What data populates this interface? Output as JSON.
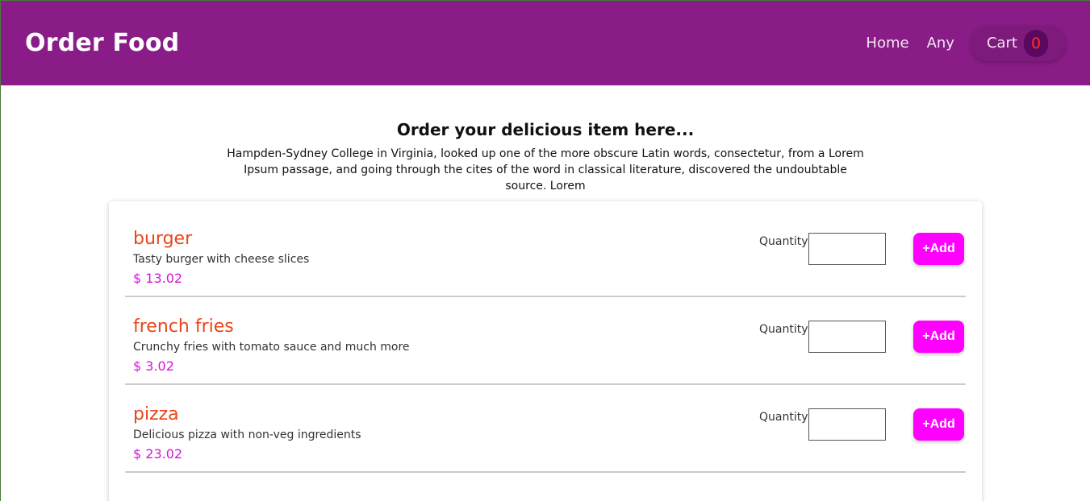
{
  "header": {
    "brand": "Order Food",
    "nav": [
      {
        "label": "Home"
      },
      {
        "label": "Any"
      }
    ],
    "cart": {
      "label": "Cart",
      "count": "0"
    }
  },
  "intro": {
    "title": "Order your delicious item here...",
    "text": "Hampden-Sydney College in Virginia, looked up one of the more obscure Latin words, consectetur, from a Lorem Ipsum passage, and going through the cites of the word in classical literature, discovered the undoubtable source. Lorem"
  },
  "meals": [
    {
      "name": "burger",
      "description": "Tasty burger with cheese slices",
      "price": "$ 13.02",
      "quantity_label": "Quantity:",
      "quantity_value": "",
      "add_label": "+Add"
    },
    {
      "name": "french fries",
      "description": "Crunchy fries with tomato sauce and much more",
      "price": "$ 3.02",
      "quantity_label": "Quantity:",
      "quantity_value": "",
      "add_label": "+Add"
    },
    {
      "name": "pizza",
      "description": "Delicious pizza with non-veg ingredients",
      "price": "$ 23.02",
      "quantity_label": "Quantity:",
      "quantity_value": "",
      "add_label": "+Add"
    }
  ],
  "colors": {
    "header_bg": "#8a1c88",
    "meal_name": "#e8461a",
    "price": "#d615d8",
    "add_button": "#ff00ff",
    "cart_badge_text": "#ff2d2d"
  }
}
